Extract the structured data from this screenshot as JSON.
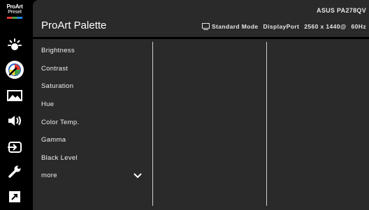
{
  "sidebar": {
    "logo_line1": "ProArt",
    "logo_line2": "Preset",
    "items": [
      {
        "icon": "brightness-icon"
      },
      {
        "icon": "palette-icon",
        "active": true
      },
      {
        "icon": "image-icon"
      },
      {
        "icon": "sound-icon"
      },
      {
        "icon": "input-select-icon"
      },
      {
        "icon": "wrench-icon"
      },
      {
        "icon": "shortcut-icon"
      }
    ]
  },
  "header": {
    "title": "ProArt Palette",
    "model": "ASUS PA278QV",
    "mode": "Standard Mode",
    "input": "DisplayPort",
    "resolution": "2560 x 1440@",
    "refresh": "60Hz"
  },
  "menu": {
    "items": [
      "Brightness",
      "Contrast",
      "Saturation",
      "Hue",
      "Color Temp.",
      "Gamma",
      "Black Level"
    ],
    "more_label": "more"
  },
  "colors": {
    "panel_bg": "#2a2a2a",
    "background": "#000000",
    "text": "#ffffff"
  }
}
